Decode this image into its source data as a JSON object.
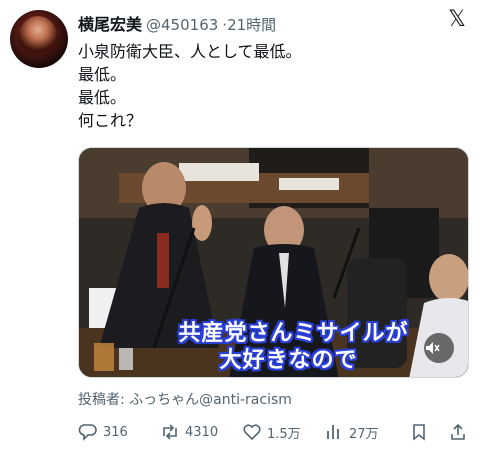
{
  "author": {
    "name": "横尾宏美",
    "handle": "@450163",
    "time": "21時間"
  },
  "tweet": {
    "lines": [
      "小泉防衛大臣、人として最低。",
      "最低。",
      "最低。",
      "何これ？"
    ]
  },
  "video": {
    "caption_line1": "共産党さんミサイルが",
    "caption_line2": "大好きなので"
  },
  "contributor_note": "投稿者: ふっちゃん@anti-racism",
  "actions": {
    "replies": "316",
    "reposts": "4310",
    "likes": "1.5万",
    "views": "27万"
  },
  "colors": {
    "text": "#0f1419",
    "secondary": "#536471",
    "caption_outline": "#2a3fd6"
  },
  "icons": [
    "x-logo-icon",
    "reply-icon",
    "repost-icon",
    "like-icon",
    "views-icon",
    "bookmark-icon",
    "share-icon",
    "mute-icon"
  ]
}
